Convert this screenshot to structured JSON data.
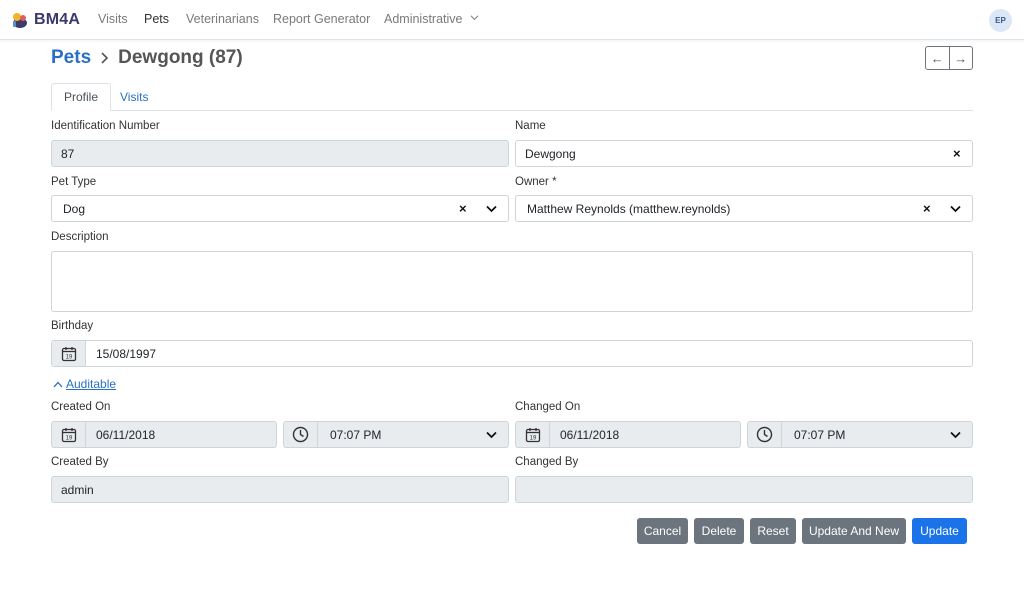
{
  "nav": {
    "brand": "BM4A",
    "items": [
      "Visits",
      "Pets",
      "Veterinarians",
      "Report Generator",
      "Administrative"
    ],
    "avatar": "EP"
  },
  "breadcrumb": {
    "parent": "Pets",
    "current": "Dewgong (87)"
  },
  "pager": {
    "prev": "←",
    "next": "→"
  },
  "tabs": [
    "Profile",
    "Visits"
  ],
  "form": {
    "identification_label": "Identification Number",
    "identification_value": "87",
    "name_label": "Name",
    "name_value": "Dewgong",
    "pet_type_label": "Pet Type",
    "pet_type_value": "Dog",
    "owner_label": "Owner *",
    "owner_value": "Matthew Reynolds (matthew.reynolds)",
    "description_label": "Description",
    "description_value": "",
    "birthday_label": "Birthday",
    "birthday_value": "15/08/1997",
    "calendar_day": "19"
  },
  "audit": {
    "toggle_label": "Auditable",
    "created_on_label": "Created On",
    "created_on_date": "06/11/2018",
    "created_on_time": "07:07 PM",
    "changed_on_label": "Changed On",
    "changed_on_date": "06/11/2018",
    "changed_on_time": "07:07 PM",
    "created_by_label": "Created By",
    "created_by_value": "admin",
    "changed_by_label": "Changed By",
    "changed_by_value": ""
  },
  "actions": {
    "cancel": "Cancel",
    "delete": "Delete",
    "reset": "Reset",
    "update_and_new": "Update And New",
    "update": "Update"
  },
  "colors": {
    "primary": "#1a73e8",
    "secondary": "#6c757d",
    "link": "#2a6fc4",
    "disabled_bg": "#e9ecef"
  }
}
